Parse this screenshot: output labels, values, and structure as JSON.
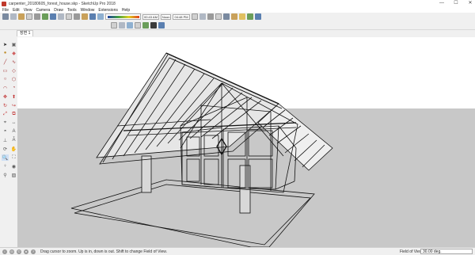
{
  "window": {
    "title": "carpenter_20180605_forest_house.skp - SketchUp Pro 2018",
    "minimize": "—",
    "maximize": "☐",
    "close": "✕"
  },
  "menu": [
    "File",
    "Edit",
    "View",
    "Camera",
    "Draw",
    "Tools",
    "Window",
    "Extensions",
    "Help"
  ],
  "toolbar": {
    "style_fields": [
      "00:43 AM",
      "Noon",
      "04:48 PM"
    ]
  },
  "scene_tab": "장면 1",
  "status": {
    "hint": "Drag cursor to zoom.  Up is in, down is out.  Shift to change Field of View.",
    "vcb_label": "Field of View",
    "vcb_value": "30.00 deg."
  },
  "colors": {
    "sky": "#ffffff",
    "ground": "#c8c8c8",
    "edges": "#111111"
  }
}
